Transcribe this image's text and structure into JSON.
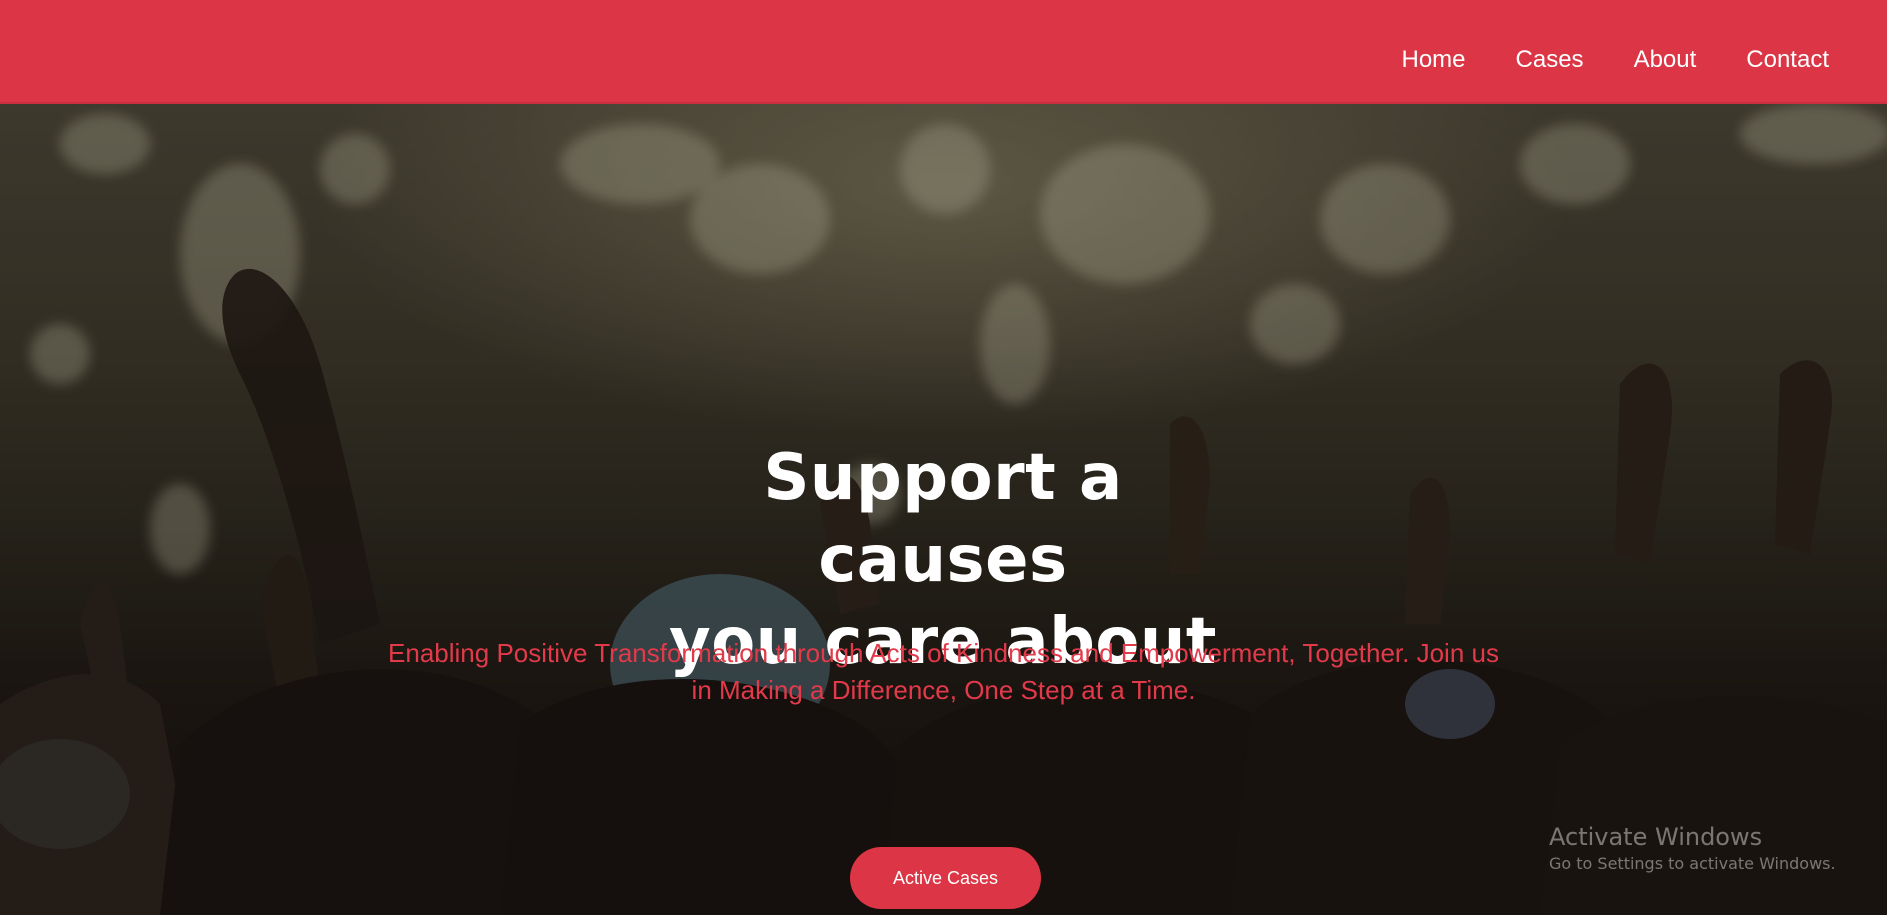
{
  "nav": {
    "links": [
      "Home",
      "Cases",
      "About",
      "Contact"
    ],
    "background_color": "#dc3545"
  },
  "hero": {
    "title_line1": "Support a causes",
    "title_line2": "you care about",
    "subtitle": "Enabling Positive Transformation through Acts of Kindness and Empowerment, Together. Join us in Making a Difference, One Step at a Time.",
    "button_label": "Active Cases",
    "accent_color": "#dc3545"
  },
  "os_watermark": {
    "title": "Activate Windows",
    "subtitle": "Go to Settings to activate Windows."
  }
}
